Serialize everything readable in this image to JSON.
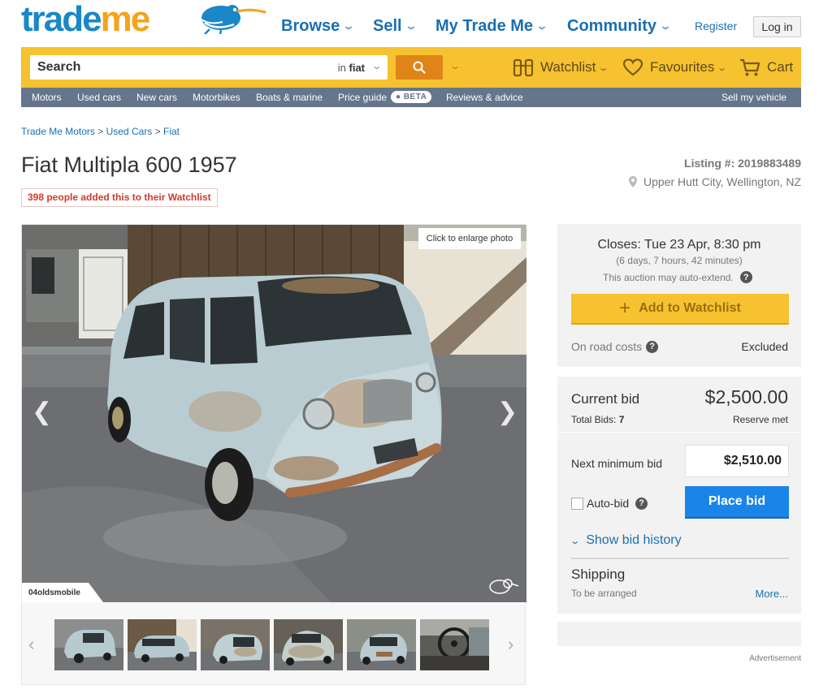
{
  "brand": {
    "part1": "trade",
    "part2": "me"
  },
  "nav": [
    {
      "label": "Browse"
    },
    {
      "label": "Sell"
    },
    {
      "label": "My Trade Me"
    },
    {
      "label": "Community"
    }
  ],
  "account": {
    "register": "Register",
    "login": "Log in"
  },
  "search": {
    "label": "Search",
    "scope_prefix": "in",
    "scope_value": "fiat"
  },
  "searchbar_links": {
    "watchlist": "Watchlist",
    "favourites": "Favourites",
    "cart": "Cart"
  },
  "subnav": {
    "items": [
      "Motors",
      "Used cars",
      "New cars",
      "Motorbikes",
      "Boats & marine",
      "Price guide"
    ],
    "beta": "● BETA",
    "reviews": "Reviews & advice",
    "sell": "Sell my vehicle"
  },
  "breadcrumb": [
    "Trade Me Motors",
    "Used Cars",
    "Fiat"
  ],
  "listing": {
    "title": "Fiat Multipla 600 1957",
    "watchers": "398 people added this to their Watchlist",
    "listing_number": "Listing #: 2019883489",
    "location": "Upper Hutt City, Wellington, NZ"
  },
  "photo": {
    "enlarge": "Click to enlarge photo",
    "credit": "04oldsmobile",
    "thumbnail_count": 6
  },
  "auction": {
    "closes": "Closes: Tue 23 Apr, 8:30 pm",
    "remaining": "(6 days, 7 hours, 42 minutes)",
    "auto_extend": "This auction may auto-extend.",
    "add_watchlist": "Add to Watchlist",
    "on_road_label": "On road costs",
    "on_road_value": "Excluded"
  },
  "bid": {
    "current_label": "Current bid",
    "current_amount": "$2,500.00",
    "total_bids_label": "Total Bids:",
    "total_bids": "7",
    "reserve": "Reserve met",
    "next_min_label": "Next minimum bid",
    "next_min_value": "$2,510.00",
    "autobid": "Auto-bid",
    "place_bid": "Place bid",
    "history": "Show bid history",
    "shipping_label": "Shipping",
    "shipping_value": "To be arranged",
    "more": "More..."
  },
  "advertisement": "Advertisement",
  "colors": {
    "brand_blue": "#1a87c8",
    "brand_orange": "#f5a31a",
    "search_yellow": "#f6c230",
    "subnav": "#65758c",
    "primary_button": "#1a85e8"
  }
}
